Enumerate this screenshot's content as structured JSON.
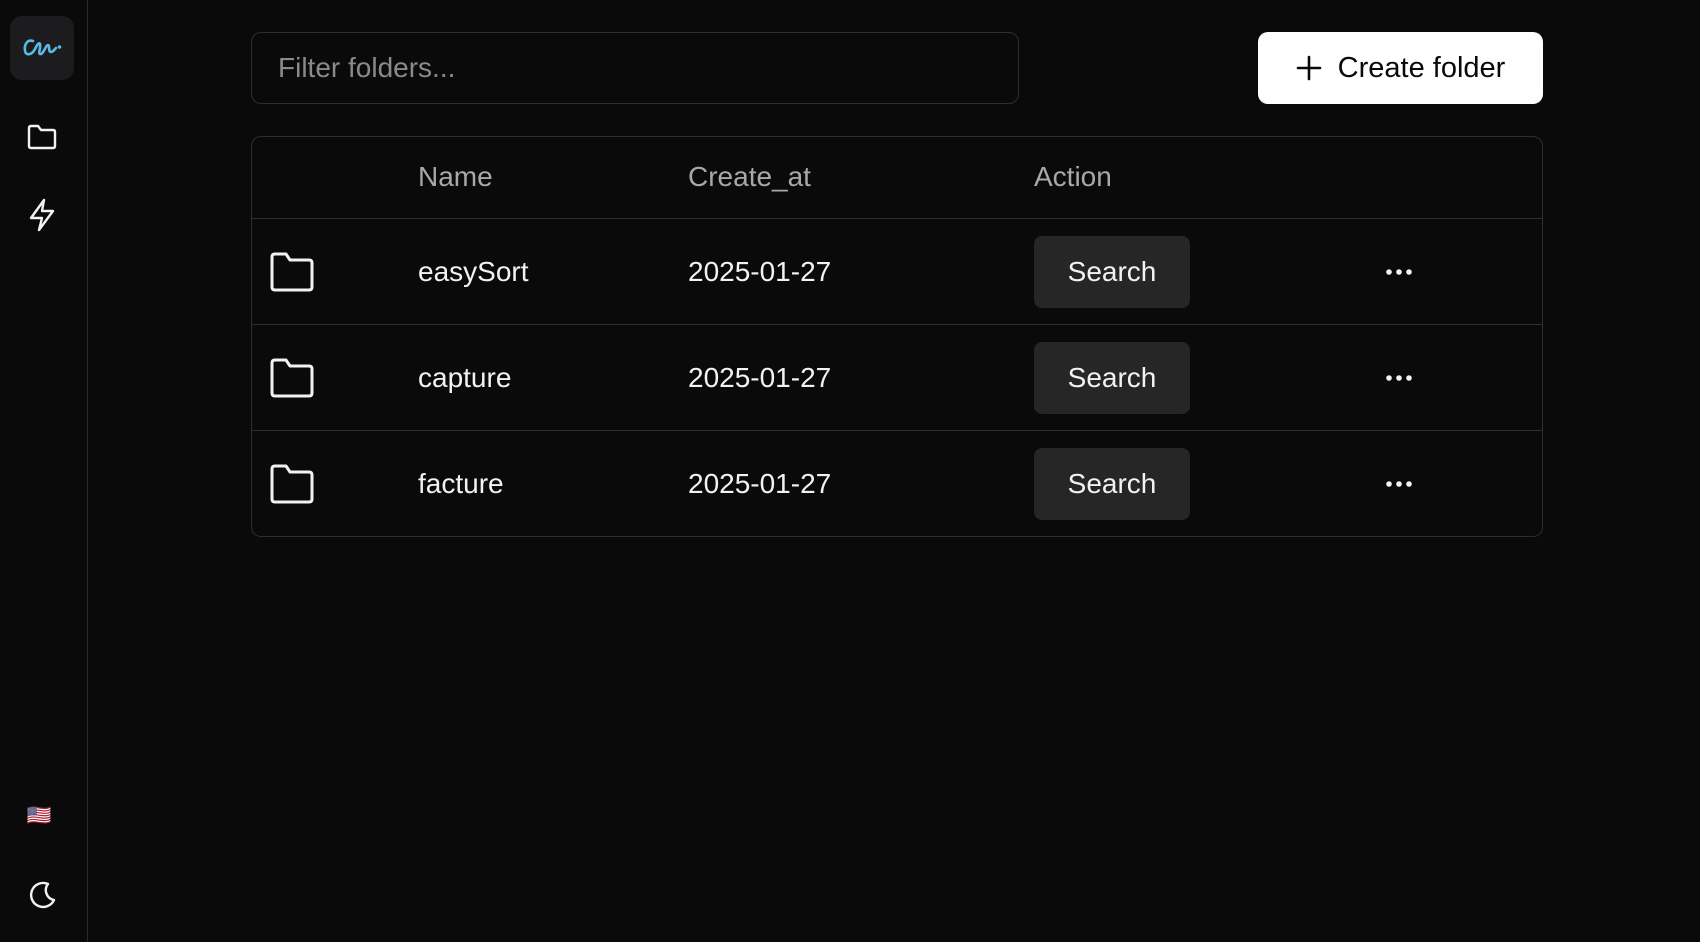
{
  "sidebar": {
    "logo_icon": "signature-logo-icon",
    "logo_color": "#5ab8e6",
    "items": [
      {
        "icon": "folder-icon"
      },
      {
        "icon": "lightning-icon"
      }
    ],
    "language_flag": "🇺🇸",
    "theme_icon": "moon-icon"
  },
  "filter": {
    "placeholder": "Filter folders...",
    "value": ""
  },
  "create_button": {
    "icon": "plus-icon",
    "label": "Create folder"
  },
  "table": {
    "columns": [
      "Name",
      "Create_at",
      "Action"
    ],
    "rows": [
      {
        "icon": "folder-icon",
        "name": "easySort",
        "created_at": "2025-01-27",
        "action_label": "Search"
      },
      {
        "icon": "folder-icon",
        "name": "capture",
        "created_at": "2025-01-27",
        "action_label": "Search"
      },
      {
        "icon": "folder-icon",
        "name": "facture",
        "created_at": "2025-01-27",
        "action_label": "Search"
      }
    ]
  },
  "colors": {
    "background": "#0a0a0a",
    "border": "#2e2e2e",
    "button_secondary": "#262626",
    "button_primary": "#ffffff"
  }
}
